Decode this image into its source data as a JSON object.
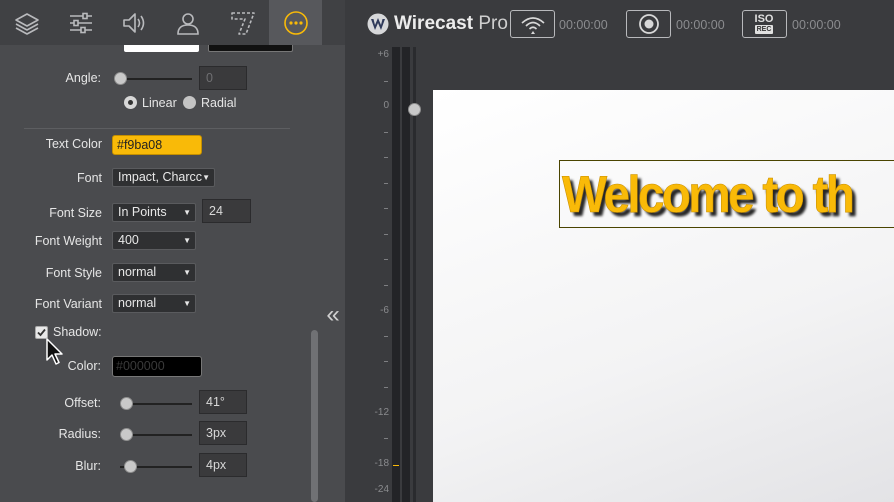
{
  "tabs": [
    {
      "name": "layers",
      "icon": "layers-icon"
    },
    {
      "name": "adjustments",
      "icon": "sliders-icon"
    },
    {
      "name": "audio",
      "icon": "speaker-icon"
    },
    {
      "name": "user",
      "icon": "user-icon"
    },
    {
      "name": "title",
      "icon": "title-seven-icon"
    },
    {
      "name": "more",
      "icon": "more-dots-icon",
      "active": true
    }
  ],
  "props": {
    "angle_label": "Angle:",
    "angle_value": "0",
    "gradient_linear": "Linear",
    "gradient_radial": "Radial",
    "text_color_label": "Text Color",
    "text_color_value": "#f9ba08",
    "font_label": "Font",
    "font_value": "Impact, Charcc",
    "font_size_label": "Font Size",
    "font_size_unit": "In Points",
    "font_size_value": "24",
    "font_weight_label": "Font Weight",
    "font_weight_value": "400",
    "font_style_label": "Font Style",
    "font_style_value": "normal",
    "font_variant_label": "Font Variant",
    "font_variant_value": "normal",
    "shadow_label": "Shadow:",
    "shadow_checked": true,
    "shadow_color_label": "Color:",
    "shadow_color_value": "#000000",
    "offset_label": "Offset:",
    "offset_value": "41°",
    "radius_label": "Radius:",
    "radius_value": "3px",
    "blur_label": "Blur:",
    "blur_value": "4px"
  },
  "topbar": {
    "app_name": "Wirecast",
    "app_edition": "Pro",
    "stream_time": "00:00:00",
    "record_time": "00:00:00",
    "iso_label": "ISO",
    "iso_sub": "REC",
    "iso_time": "00:00:00"
  },
  "collapse_glyph": "«",
  "meter_ticks": [
    "+6",
    "0",
    "-6",
    "-12",
    "-18",
    "-24"
  ],
  "preview": {
    "title_text": "Welcome to th",
    "title_color": "#f9ba08"
  },
  "colors": {
    "accent": "#f9ba08",
    "panel": "#4a4b4e"
  }
}
